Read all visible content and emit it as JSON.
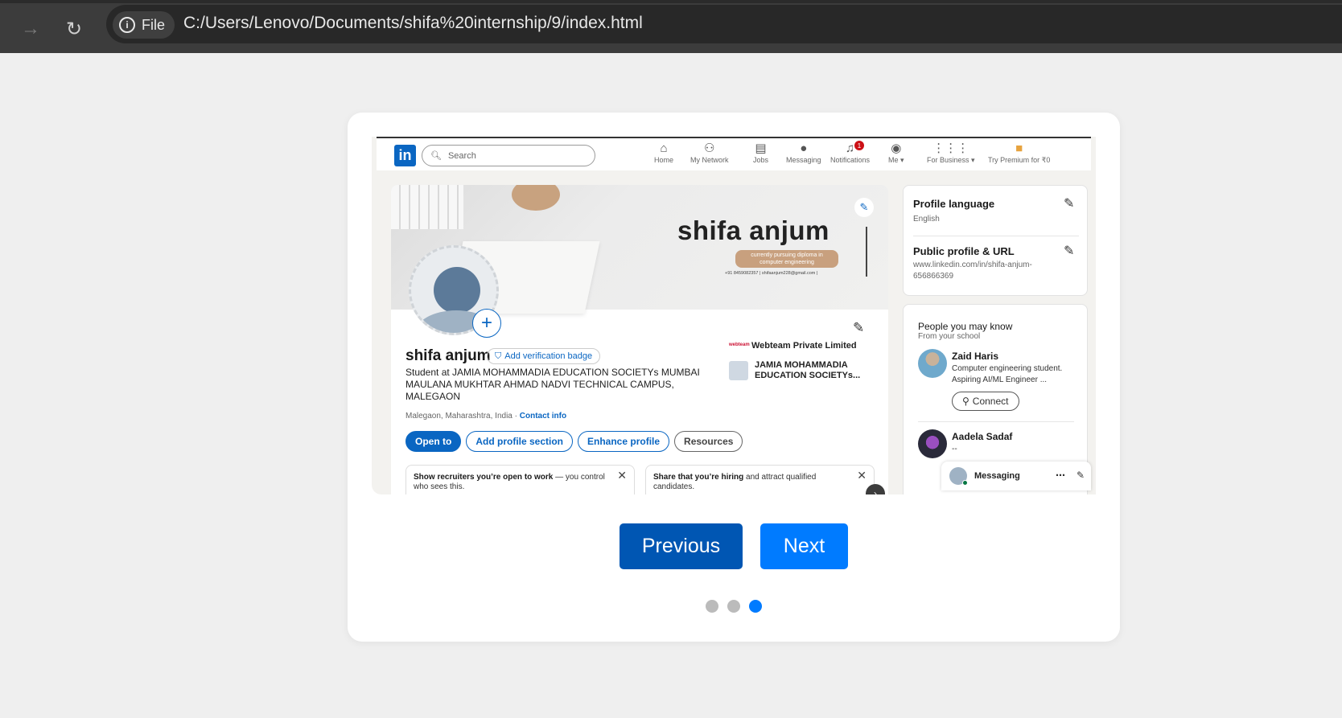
{
  "browser": {
    "site_chip": "File",
    "url": "C:/Users/Lenovo/Documents/shifa%20internship/9/index.html"
  },
  "linkedin": {
    "logo": "in",
    "search_placeholder": "Search",
    "nav": [
      {
        "icon": "home-icon",
        "label": "Home"
      },
      {
        "icon": "network-icon",
        "label": "My Network"
      },
      {
        "icon": "briefcase-icon",
        "label": "Jobs"
      },
      {
        "icon": "chat-icon",
        "label": "Messaging"
      },
      {
        "icon": "bell-icon",
        "label": "Notifications",
        "badge": "1"
      },
      {
        "icon": "avatar-icon",
        "label": "Me ▾"
      },
      {
        "icon": "grid-icon",
        "label": "For Business ▾"
      },
      {
        "icon": "premium-icon",
        "label": "Try Premium for ₹0"
      }
    ]
  },
  "banner": {
    "name": "shifa anjum",
    "pill_line1": "currently pursuing diploma in",
    "pill_line2": "computer engineering",
    "contact": "+91 8459082357  |  shifaanjum228@gmail.com |"
  },
  "profile": {
    "name": "shifa anjum",
    "verify_label": "Add verification badge",
    "headline": "Student at JAMIA MOHAMMADIA EDUCATION SOCIETYs MUMBAI MAULANA MUKHTAR AHMAD NADVI TECHNICAL CAMPUS, MALEGAON",
    "location": "Malegaon, Maharashtra, India ·",
    "contact_info": "Contact info",
    "company": "Webteam Private Limited",
    "company_logo_text": "webteam",
    "school_line1": "JAMIA MOHAMMADIA",
    "school_line2": "EDUCATION SOCIETYs...",
    "buttons": [
      "Open to",
      "Add profile section",
      "Enhance profile",
      "Resources"
    ],
    "notice1_bold": "Show recruiters you’re open to work",
    "notice1_rest": " — you control who sees this.",
    "notice2_bold": "Share that you’re hiring",
    "notice2_rest": " and attract qualified candidates."
  },
  "side": {
    "lang_title": "Profile language",
    "lang_value": "English",
    "url_title": "Public profile & URL",
    "url_value": "www.linkedin.com/in/shifa-anjum-656866369",
    "pymk_title": "People you may know",
    "pymk_sub": "From your school",
    "person1_name": "Zaid Haris",
    "person1_desc": "Computer engineering student. Aspiring AI/ML Engineer ...",
    "connect_label": "Connect",
    "person2_name": "Aadela Sadaf",
    "person2_desc": "--",
    "messaging": "Messaging"
  },
  "slideshow": {
    "prev_label": "Previous",
    "next_label": "Next",
    "total_slides": 3,
    "active_slide": 3,
    "accent": "#007bff"
  }
}
